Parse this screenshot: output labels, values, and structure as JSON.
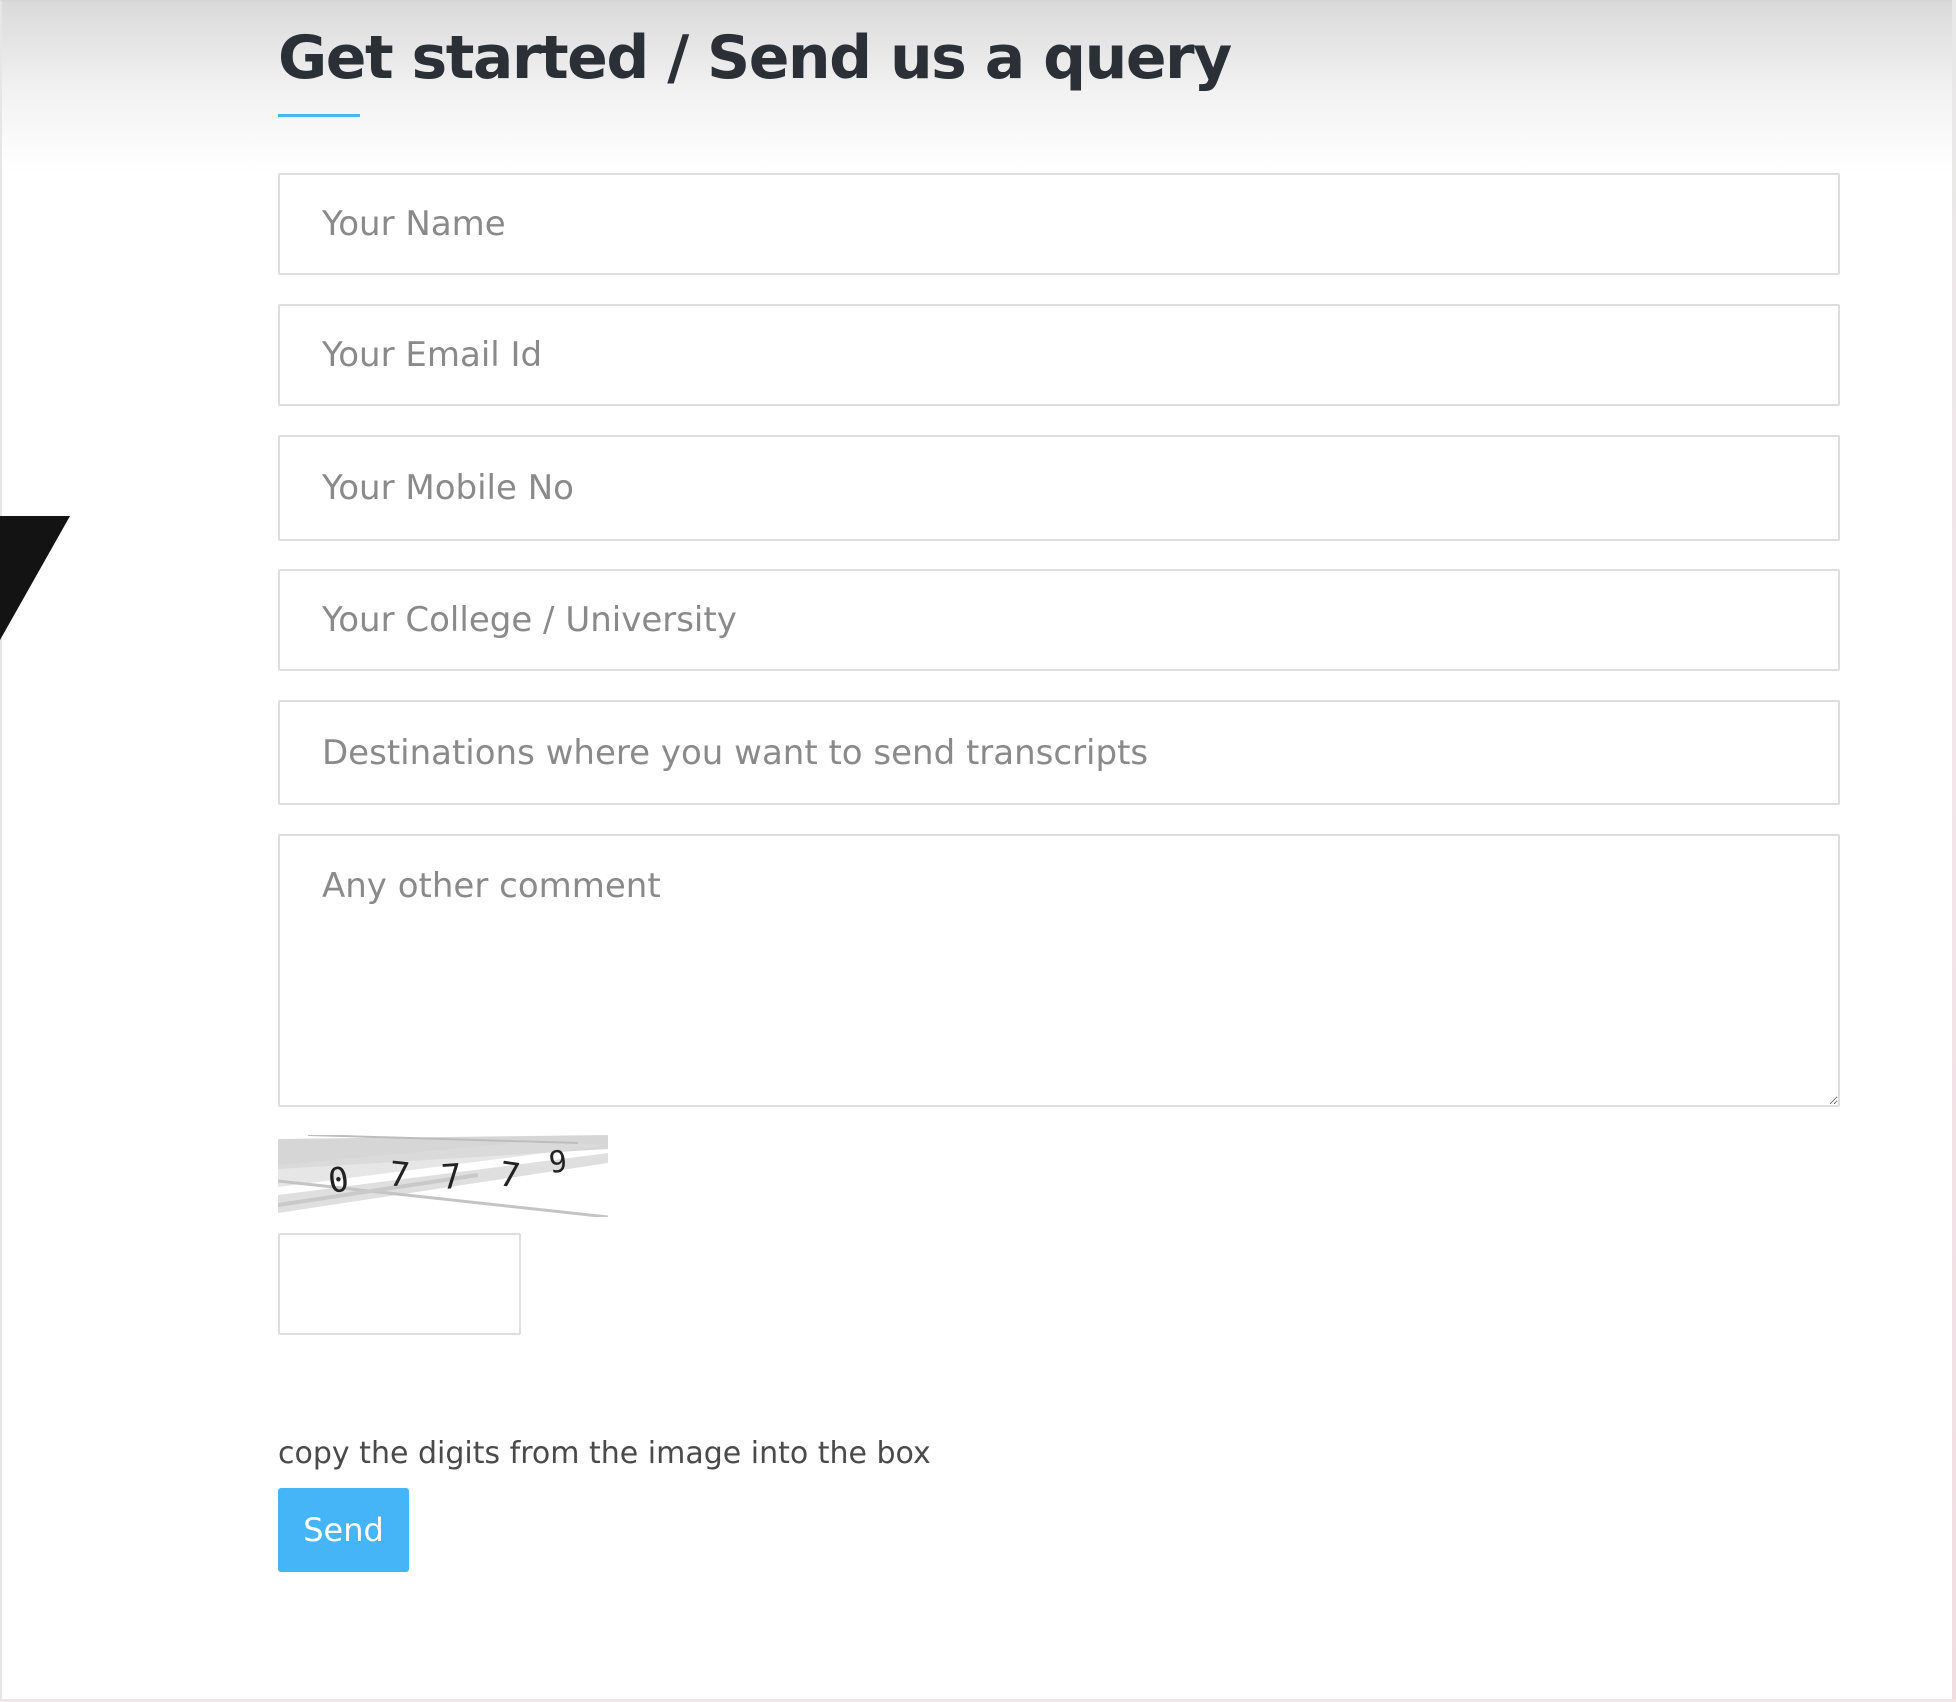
{
  "form": {
    "title": "Get started / Send us a query",
    "fields": {
      "name_placeholder": "Your Name",
      "email_placeholder": "Your Email Id",
      "mobile_placeholder": "Your Mobile No",
      "college_placeholder": "Your College / University",
      "destinations_placeholder": "Destinations where you want to send transcripts",
      "comment_placeholder": "Any other comment"
    },
    "captcha": {
      "digits": [
        "0",
        "7",
        "7",
        "7",
        "9"
      ],
      "input_value": "",
      "hint": "copy the digits from the image into the box"
    },
    "send_label": "Send"
  },
  "colors": {
    "accent": "#4bb6f2",
    "button": "#46b5f8",
    "title": "#2b2f36",
    "border": "#dedede",
    "placeholder": "#8a8a8a"
  }
}
